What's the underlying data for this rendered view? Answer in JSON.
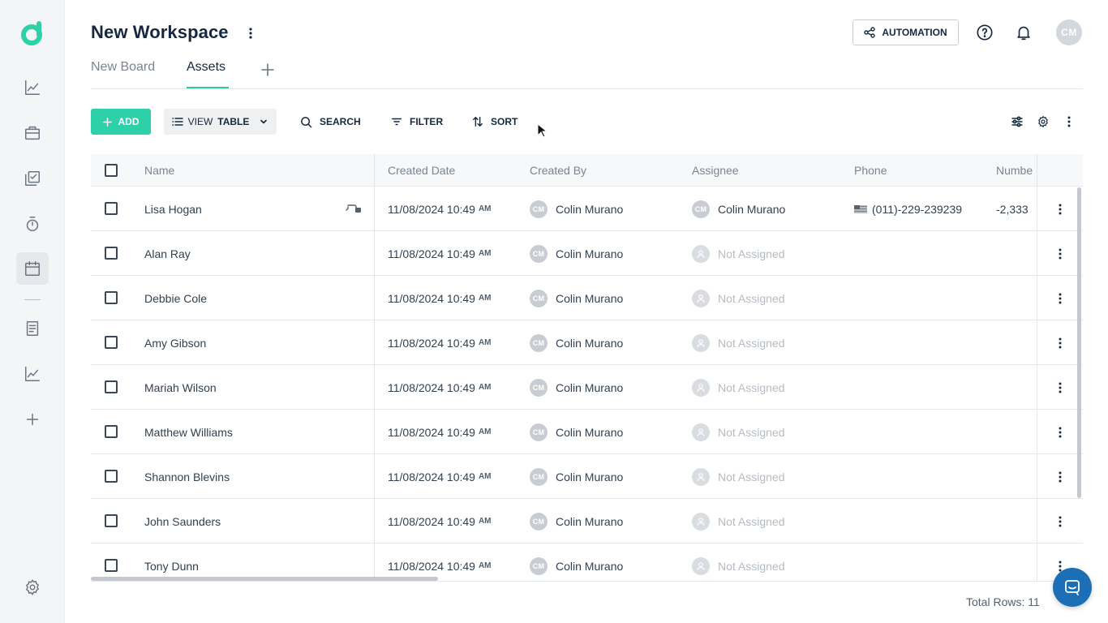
{
  "header": {
    "title": "New Workspace",
    "automation_label": "AUTOMATION",
    "avatar_initials": "CM"
  },
  "tabs": [
    {
      "label": "New Board",
      "active": false
    },
    {
      "label": "Assets",
      "active": true
    }
  ],
  "toolbar": {
    "add_label": "ADD",
    "view_prefix": "VIEW",
    "view_value": "TABLE",
    "search_label": "SEARCH",
    "filter_label": "FILTER",
    "sort_label": "SORT"
  },
  "table": {
    "columns": [
      "Name",
      "Created Date",
      "Created By",
      "Assignee",
      "Phone",
      "Numbe"
    ],
    "rows": [
      {
        "name": "Lisa Hogan",
        "date": "11/08/2024 10:49",
        "ampm": "AM",
        "creator_initials": "CM",
        "creator": "Colin Murano",
        "assignee_initials": "CM",
        "assignee": "Colin Murano",
        "assigned": true,
        "phone": "(011)-229-239239",
        "number": "-2,333"
      },
      {
        "name": "Alan Ray",
        "date": "11/08/2024 10:49",
        "ampm": "AM",
        "creator_initials": "CM",
        "creator": "Colin Murano",
        "assignee": "Not Assigned",
        "assigned": false
      },
      {
        "name": "Debbie Cole",
        "date": "11/08/2024 10:49",
        "ampm": "AM",
        "creator_initials": "CM",
        "creator": "Colin Murano",
        "assignee": "Not Assigned",
        "assigned": false
      },
      {
        "name": "Amy Gibson",
        "date": "11/08/2024 10:49",
        "ampm": "AM",
        "creator_initials": "CM",
        "creator": "Colin Murano",
        "assignee": "Not Assigned",
        "assigned": false
      },
      {
        "name": "Mariah Wilson",
        "date": "11/08/2024 10:49",
        "ampm": "AM",
        "creator_initials": "CM",
        "creator": "Colin Murano",
        "assignee": "Not Assigned",
        "assigned": false
      },
      {
        "name": "Matthew Williams",
        "date": "11/08/2024 10:49",
        "ampm": "AM",
        "creator_initials": "CM",
        "creator": "Colin Murano",
        "assignee": "Not Assigned",
        "assigned": false
      },
      {
        "name": "Shannon Blevins",
        "date": "11/08/2024 10:49",
        "ampm": "AM",
        "creator_initials": "CM",
        "creator": "Colin Murano",
        "assignee": "Not Assigned",
        "assigned": false
      },
      {
        "name": "John Saunders",
        "date": "11/08/2024 10:49",
        "ampm": "AM",
        "creator_initials": "CM",
        "creator": "Colin Murano",
        "assignee": "Not Assigned",
        "assigned": false
      },
      {
        "name": "Tony Dunn",
        "date": "11/08/2024 10:49",
        "ampm": "AM",
        "creator_initials": "CM",
        "creator": "Colin Murano",
        "assignee": "Not Assigned",
        "assigned": false
      }
    ]
  },
  "footer": {
    "total_rows": "Total Rows: 11"
  },
  "colors": {
    "accent": "#2ed0a8",
    "title": "#15283f",
    "chat": "#1c6fb6"
  }
}
